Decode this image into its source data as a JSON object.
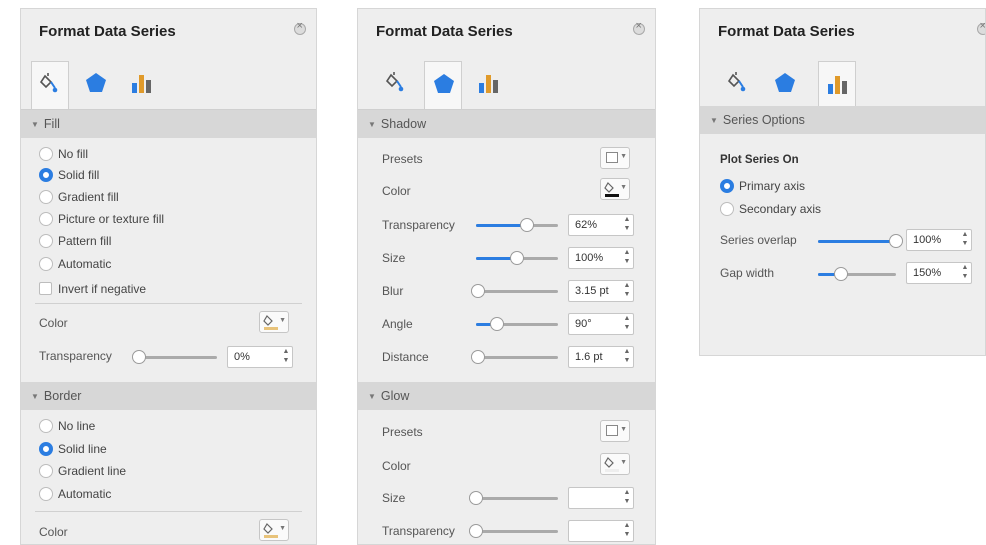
{
  "panels": [
    {
      "title": "Format Data Series",
      "active_tab": "fill-line",
      "fill": {
        "header": "Fill",
        "options": [
          "No fill",
          "Solid fill",
          "Gradient fill",
          "Picture or texture fill",
          "Pattern fill",
          "Automatic"
        ],
        "selected": "Solid fill",
        "invert_label": "Invert if negative",
        "color_label": "Color",
        "transparency_label": "Transparency",
        "transparency_value": "0%",
        "transparency_fraction": 0.0
      },
      "border": {
        "header": "Border",
        "options": [
          "No line",
          "Solid line",
          "Gradient line",
          "Automatic"
        ],
        "selected": "Solid line",
        "color_label": "Color"
      }
    },
    {
      "title": "Format Data Series",
      "active_tab": "effects",
      "shadow": {
        "header": "Shadow",
        "presets_label": "Presets",
        "color_label": "Color",
        "rows": [
          {
            "label": "Transparency",
            "value": "62%",
            "fraction": 0.62
          },
          {
            "label": "Size",
            "value": "100%",
            "fraction": 0.5
          },
          {
            "label": "Blur",
            "value": "3.15 pt",
            "fraction": 0.03
          },
          {
            "label": "Angle",
            "value": "90°",
            "fraction": 0.25
          },
          {
            "label": "Distance",
            "value": "1.6 pt",
            "fraction": 0.02
          }
        ]
      },
      "glow": {
        "header": "Glow",
        "presets_label": "Presets",
        "color_label": "Color",
        "rows": [
          {
            "label": "Size",
            "value": "",
            "fraction": 0.0
          },
          {
            "label": "Transparency",
            "value": "",
            "fraction": 0.0
          }
        ]
      }
    },
    {
      "title": "Format Data Series",
      "active_tab": "series-options",
      "series_options": {
        "header": "Series Options",
        "plot_on_label": "Plot Series On",
        "axis_options": [
          "Primary axis",
          "Secondary axis"
        ],
        "selected": "Primary axis",
        "rows": [
          {
            "label": "Series overlap",
            "value": "100%",
            "fraction": 1.0
          },
          {
            "label": "Gap width",
            "value": "150%",
            "fraction": 0.3
          }
        ]
      }
    }
  ],
  "colors": {
    "accent": "#2b7de1",
    "panel_bg": "#eeeeee",
    "header_bg": "#d7d7d7",
    "bucket_fill": "#e8c37a"
  },
  "icons": {
    "tab1": "paint-bucket-icon",
    "tab2": "pentagon-icon",
    "tab3": "bar-chart-icon",
    "close": "close-icon",
    "color_button": "paint-bucket-icon"
  }
}
